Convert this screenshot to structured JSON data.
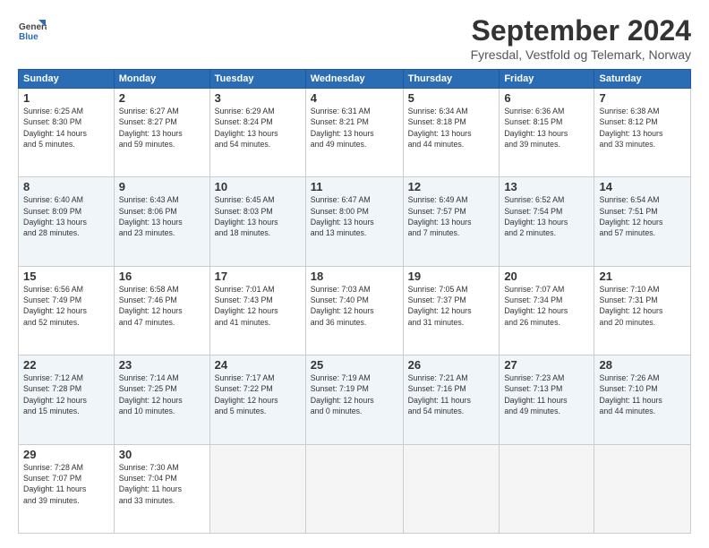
{
  "header": {
    "logo_line1": "General",
    "logo_line2": "Blue",
    "main_title": "September 2024",
    "subtitle": "Fyresdal, Vestfold og Telemark, Norway"
  },
  "calendar": {
    "headers": [
      "Sunday",
      "Monday",
      "Tuesday",
      "Wednesday",
      "Thursday",
      "Friday",
      "Saturday"
    ],
    "weeks": [
      [
        {
          "num": "",
          "text": ""
        },
        {
          "num": "2",
          "text": "Sunrise: 6:27 AM\nSunset: 8:27 PM\nDaylight: 13 hours\nand 59 minutes."
        },
        {
          "num": "3",
          "text": "Sunrise: 6:29 AM\nSunset: 8:24 PM\nDaylight: 13 hours\nand 54 minutes."
        },
        {
          "num": "4",
          "text": "Sunrise: 6:31 AM\nSunset: 8:21 PM\nDaylight: 13 hours\nand 49 minutes."
        },
        {
          "num": "5",
          "text": "Sunrise: 6:34 AM\nSunset: 8:18 PM\nDaylight: 13 hours\nand 44 minutes."
        },
        {
          "num": "6",
          "text": "Sunrise: 6:36 AM\nSunset: 8:15 PM\nDaylight: 13 hours\nand 39 minutes."
        },
        {
          "num": "7",
          "text": "Sunrise: 6:38 AM\nSunset: 8:12 PM\nDaylight: 13 hours\nand 33 minutes."
        }
      ],
      [
        {
          "num": "1",
          "text": "Sunrise: 6:25 AM\nSunset: 8:30 PM\nDaylight: 14 hours\nand 5 minutes."
        },
        {
          "num": "",
          "text": ""
        },
        {
          "num": "",
          "text": ""
        },
        {
          "num": "",
          "text": ""
        },
        {
          "num": "",
          "text": ""
        },
        {
          "num": "",
          "text": ""
        },
        {
          "num": "",
          "text": ""
        }
      ],
      [
        {
          "num": "8",
          "text": "Sunrise: 6:40 AM\nSunset: 8:09 PM\nDaylight: 13 hours\nand 28 minutes."
        },
        {
          "num": "9",
          "text": "Sunrise: 6:43 AM\nSunset: 8:06 PM\nDaylight: 13 hours\nand 23 minutes."
        },
        {
          "num": "10",
          "text": "Sunrise: 6:45 AM\nSunset: 8:03 PM\nDaylight: 13 hours\nand 18 minutes."
        },
        {
          "num": "11",
          "text": "Sunrise: 6:47 AM\nSunset: 8:00 PM\nDaylight: 13 hours\nand 13 minutes."
        },
        {
          "num": "12",
          "text": "Sunrise: 6:49 AM\nSunset: 7:57 PM\nDaylight: 13 hours\nand 7 minutes."
        },
        {
          "num": "13",
          "text": "Sunrise: 6:52 AM\nSunset: 7:54 PM\nDaylight: 13 hours\nand 2 minutes."
        },
        {
          "num": "14",
          "text": "Sunrise: 6:54 AM\nSunset: 7:51 PM\nDaylight: 12 hours\nand 57 minutes."
        }
      ],
      [
        {
          "num": "15",
          "text": "Sunrise: 6:56 AM\nSunset: 7:49 PM\nDaylight: 12 hours\nand 52 minutes."
        },
        {
          "num": "16",
          "text": "Sunrise: 6:58 AM\nSunset: 7:46 PM\nDaylight: 12 hours\nand 47 minutes."
        },
        {
          "num": "17",
          "text": "Sunrise: 7:01 AM\nSunset: 7:43 PM\nDaylight: 12 hours\nand 41 minutes."
        },
        {
          "num": "18",
          "text": "Sunrise: 7:03 AM\nSunset: 7:40 PM\nDaylight: 12 hours\nand 36 minutes."
        },
        {
          "num": "19",
          "text": "Sunrise: 7:05 AM\nSunset: 7:37 PM\nDaylight: 12 hours\nand 31 minutes."
        },
        {
          "num": "20",
          "text": "Sunrise: 7:07 AM\nSunset: 7:34 PM\nDaylight: 12 hours\nand 26 minutes."
        },
        {
          "num": "21",
          "text": "Sunrise: 7:10 AM\nSunset: 7:31 PM\nDaylight: 12 hours\nand 20 minutes."
        }
      ],
      [
        {
          "num": "22",
          "text": "Sunrise: 7:12 AM\nSunset: 7:28 PM\nDaylight: 12 hours\nand 15 minutes."
        },
        {
          "num": "23",
          "text": "Sunrise: 7:14 AM\nSunset: 7:25 PM\nDaylight: 12 hours\nand 10 minutes."
        },
        {
          "num": "24",
          "text": "Sunrise: 7:17 AM\nSunset: 7:22 PM\nDaylight: 12 hours\nand 5 minutes."
        },
        {
          "num": "25",
          "text": "Sunrise: 7:19 AM\nSunset: 7:19 PM\nDaylight: 12 hours\nand 0 minutes."
        },
        {
          "num": "26",
          "text": "Sunrise: 7:21 AM\nSunset: 7:16 PM\nDaylight: 11 hours\nand 54 minutes."
        },
        {
          "num": "27",
          "text": "Sunrise: 7:23 AM\nSunset: 7:13 PM\nDaylight: 11 hours\nand 49 minutes."
        },
        {
          "num": "28",
          "text": "Sunrise: 7:26 AM\nSunset: 7:10 PM\nDaylight: 11 hours\nand 44 minutes."
        }
      ],
      [
        {
          "num": "29",
          "text": "Sunrise: 7:28 AM\nSunset: 7:07 PM\nDaylight: 11 hours\nand 39 minutes."
        },
        {
          "num": "30",
          "text": "Sunrise: 7:30 AM\nSunset: 7:04 PM\nDaylight: 11 hours\nand 33 minutes."
        },
        {
          "num": "",
          "text": ""
        },
        {
          "num": "",
          "text": ""
        },
        {
          "num": "",
          "text": ""
        },
        {
          "num": "",
          "text": ""
        },
        {
          "num": "",
          "text": ""
        }
      ]
    ]
  }
}
